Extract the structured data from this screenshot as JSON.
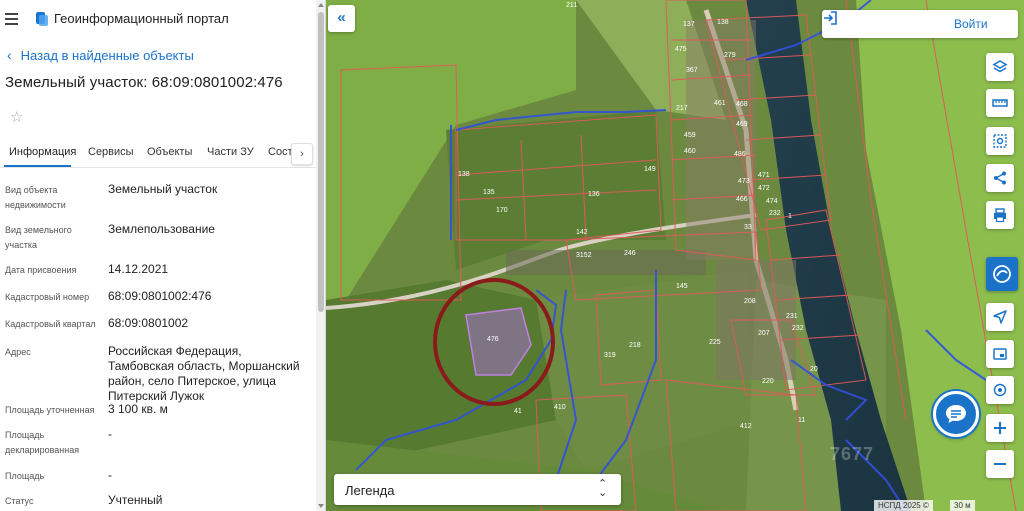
{
  "app": {
    "title": "Геоинформационный портал"
  },
  "nav": {
    "back_label": "Назад в найденные объекты"
  },
  "object": {
    "title": "Земельный участок: 68:09:0801002:476"
  },
  "tabs": [
    {
      "label": "Информация",
      "active": true
    },
    {
      "label": "Сервисы"
    },
    {
      "label": "Объекты"
    },
    {
      "label": "Части ЗУ"
    },
    {
      "label": "Соста"
    }
  ],
  "tab_next_icon": "›",
  "properties": [
    {
      "label": "Вид объекта недвижимости",
      "value": "Земельный участок"
    },
    {
      "label": "Вид земельного участка",
      "value": "Землепользование"
    },
    {
      "label": "Дата присвоения",
      "value": "14.12.2021"
    },
    {
      "label": "Кадастровый номер",
      "value": "68:09:0801002:476"
    },
    {
      "label": "Кадастровый квартал",
      "value": "68:09:0801002"
    },
    {
      "label": "Адрес",
      "value": "Российская Федерация, Тамбовская область, Моршанский район, село Питерское, улица Питерский Лужок"
    },
    {
      "label": "Площадь уточненная",
      "value": "3 100 кв. м"
    },
    {
      "label": "Площадь декларированная",
      "value": "-"
    },
    {
      "label": "Площадь",
      "value": "-"
    },
    {
      "label": "Статус",
      "value": "Учтенный"
    }
  ],
  "map": {
    "collapse_icon": "«",
    "login_label": "Войти",
    "legend_label": "Легенда",
    "attribution": "НСПД 2025 ©",
    "scale_label": "30 м",
    "watermark": "7677",
    "parcel_labels": [
      "211",
      "137",
      "138",
      "475",
      "279",
      "367",
      "461",
      "468",
      "217",
      "459",
      "469",
      "486",
      "460",
      "473",
      "471",
      "466",
      "472",
      "474",
      "33",
      "232",
      "1",
      "136",
      "138",
      "149",
      "135",
      "170",
      "142",
      "3152",
      "246",
      "145",
      "208",
      "476",
      "319",
      "218",
      "225",
      "207",
      "231",
      "232",
      "220",
      "41",
      "410",
      "412",
      "11",
      "20"
    ],
    "colors": {
      "parcel_border": "#e05a5a",
      "selected_fill": "#a070c8",
      "highlight_circle": "#8b1a1a",
      "blue_line": "#3050e0",
      "river": "#1e3a4a",
      "accent": "#1a73c8"
    }
  }
}
